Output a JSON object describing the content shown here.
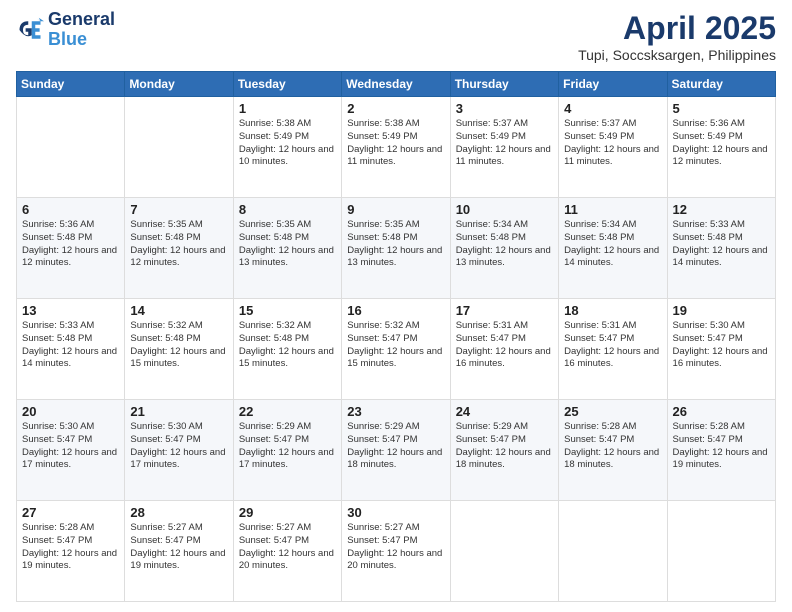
{
  "logo": {
    "line1": "General",
    "line2": "Blue"
  },
  "title": "April 2025",
  "subtitle": "Tupi, Soccsksargen, Philippines",
  "days_header": [
    "Sunday",
    "Monday",
    "Tuesday",
    "Wednesday",
    "Thursday",
    "Friday",
    "Saturday"
  ],
  "weeks": [
    [
      {
        "day": "",
        "info": ""
      },
      {
        "day": "",
        "info": ""
      },
      {
        "day": "1",
        "info": "Sunrise: 5:38 AM\nSunset: 5:49 PM\nDaylight: 12 hours and 10 minutes."
      },
      {
        "day": "2",
        "info": "Sunrise: 5:38 AM\nSunset: 5:49 PM\nDaylight: 12 hours and 11 minutes."
      },
      {
        "day": "3",
        "info": "Sunrise: 5:37 AM\nSunset: 5:49 PM\nDaylight: 12 hours and 11 minutes."
      },
      {
        "day": "4",
        "info": "Sunrise: 5:37 AM\nSunset: 5:49 PM\nDaylight: 12 hours and 11 minutes."
      },
      {
        "day": "5",
        "info": "Sunrise: 5:36 AM\nSunset: 5:49 PM\nDaylight: 12 hours and 12 minutes."
      }
    ],
    [
      {
        "day": "6",
        "info": "Sunrise: 5:36 AM\nSunset: 5:48 PM\nDaylight: 12 hours and 12 minutes."
      },
      {
        "day": "7",
        "info": "Sunrise: 5:35 AM\nSunset: 5:48 PM\nDaylight: 12 hours and 12 minutes."
      },
      {
        "day": "8",
        "info": "Sunrise: 5:35 AM\nSunset: 5:48 PM\nDaylight: 12 hours and 13 minutes."
      },
      {
        "day": "9",
        "info": "Sunrise: 5:35 AM\nSunset: 5:48 PM\nDaylight: 12 hours and 13 minutes."
      },
      {
        "day": "10",
        "info": "Sunrise: 5:34 AM\nSunset: 5:48 PM\nDaylight: 12 hours and 13 minutes."
      },
      {
        "day": "11",
        "info": "Sunrise: 5:34 AM\nSunset: 5:48 PM\nDaylight: 12 hours and 14 minutes."
      },
      {
        "day": "12",
        "info": "Sunrise: 5:33 AM\nSunset: 5:48 PM\nDaylight: 12 hours and 14 minutes."
      }
    ],
    [
      {
        "day": "13",
        "info": "Sunrise: 5:33 AM\nSunset: 5:48 PM\nDaylight: 12 hours and 14 minutes."
      },
      {
        "day": "14",
        "info": "Sunrise: 5:32 AM\nSunset: 5:48 PM\nDaylight: 12 hours and 15 minutes."
      },
      {
        "day": "15",
        "info": "Sunrise: 5:32 AM\nSunset: 5:48 PM\nDaylight: 12 hours and 15 minutes."
      },
      {
        "day": "16",
        "info": "Sunrise: 5:32 AM\nSunset: 5:47 PM\nDaylight: 12 hours and 15 minutes."
      },
      {
        "day": "17",
        "info": "Sunrise: 5:31 AM\nSunset: 5:47 PM\nDaylight: 12 hours and 16 minutes."
      },
      {
        "day": "18",
        "info": "Sunrise: 5:31 AM\nSunset: 5:47 PM\nDaylight: 12 hours and 16 minutes."
      },
      {
        "day": "19",
        "info": "Sunrise: 5:30 AM\nSunset: 5:47 PM\nDaylight: 12 hours and 16 minutes."
      }
    ],
    [
      {
        "day": "20",
        "info": "Sunrise: 5:30 AM\nSunset: 5:47 PM\nDaylight: 12 hours and 17 minutes."
      },
      {
        "day": "21",
        "info": "Sunrise: 5:30 AM\nSunset: 5:47 PM\nDaylight: 12 hours and 17 minutes."
      },
      {
        "day": "22",
        "info": "Sunrise: 5:29 AM\nSunset: 5:47 PM\nDaylight: 12 hours and 17 minutes."
      },
      {
        "day": "23",
        "info": "Sunrise: 5:29 AM\nSunset: 5:47 PM\nDaylight: 12 hours and 18 minutes."
      },
      {
        "day": "24",
        "info": "Sunrise: 5:29 AM\nSunset: 5:47 PM\nDaylight: 12 hours and 18 minutes."
      },
      {
        "day": "25",
        "info": "Sunrise: 5:28 AM\nSunset: 5:47 PM\nDaylight: 12 hours and 18 minutes."
      },
      {
        "day": "26",
        "info": "Sunrise: 5:28 AM\nSunset: 5:47 PM\nDaylight: 12 hours and 19 minutes."
      }
    ],
    [
      {
        "day": "27",
        "info": "Sunrise: 5:28 AM\nSunset: 5:47 PM\nDaylight: 12 hours and 19 minutes."
      },
      {
        "day": "28",
        "info": "Sunrise: 5:27 AM\nSunset: 5:47 PM\nDaylight: 12 hours and 19 minutes."
      },
      {
        "day": "29",
        "info": "Sunrise: 5:27 AM\nSunset: 5:47 PM\nDaylight: 12 hours and 20 minutes."
      },
      {
        "day": "30",
        "info": "Sunrise: 5:27 AM\nSunset: 5:47 PM\nDaylight: 12 hours and 20 minutes."
      },
      {
        "day": "",
        "info": ""
      },
      {
        "day": "",
        "info": ""
      },
      {
        "day": "",
        "info": ""
      }
    ]
  ]
}
